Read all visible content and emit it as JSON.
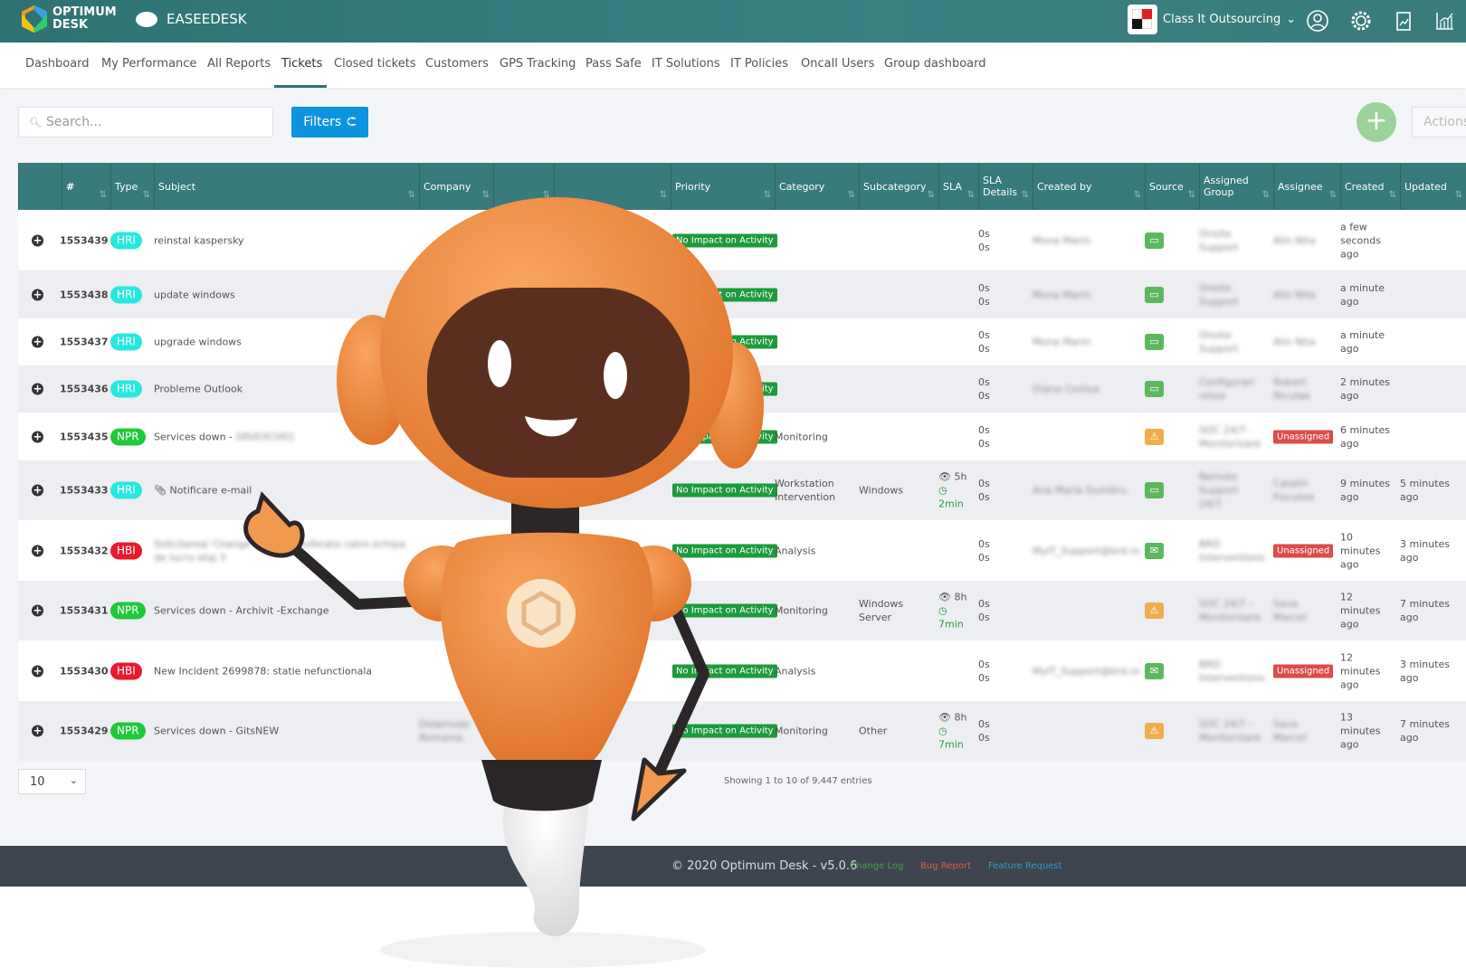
{
  "brand": {
    "logo_text_1": "OPTIMUM",
    "logo_text_2": "DESK",
    "product": "EASEEDESK"
  },
  "topbar": {
    "company": "Class It Outsourcing",
    "icons": [
      "user-circle-icon",
      "gear-icon",
      "clipboard-chart-icon",
      "bar-chart-icon"
    ]
  },
  "nav": {
    "items": [
      "Dashboard",
      "My Performance",
      "All Reports",
      "Tickets",
      "Closed tickets",
      "Customers",
      "GPS Tracking",
      "Pass Safe",
      "IT Solutions",
      "IT Policies",
      "Oncall Users",
      "Group dashboard"
    ],
    "active": "Tickets"
  },
  "toolbar": {
    "search_placeholder": "Search...",
    "filters_label": "Filters",
    "add_label": "+",
    "actions_label": "Actions"
  },
  "table": {
    "columns": [
      "#",
      "Type",
      "Subject",
      "Company",
      "",
      "",
      "Priority",
      "Category",
      "Subcategory",
      "SLA",
      "SLA Details",
      "Created by",
      "Source",
      "Assigned Group",
      "Assignee",
      "Created",
      "Updated"
    ],
    "rows": [
      {
        "id": "1553439",
        "type": "HRI",
        "subject": "reinstal kaspersky",
        "priority": "No Impact on Activity",
        "category": "",
        "subcategory": "",
        "sla": "",
        "sla_time": "",
        "sla_details": [
          "0s",
          "0s"
        ],
        "created_by": "Mona Marin",
        "source": "monitor",
        "group": "Onsite Support",
        "assignee": "Alin Nita",
        "created": "a few seconds ago",
        "updated": ""
      },
      {
        "id": "1553438",
        "type": "HRI",
        "subject": "update windows",
        "priority": "No Impact on Activity",
        "category": "",
        "subcategory": "",
        "sla": "",
        "sla_time": "",
        "sla_details": [
          "0s",
          "0s"
        ],
        "created_by": "Mona Marin",
        "source": "monitor",
        "group": "Onsite Support",
        "assignee": "Alin Nita",
        "created": "a minute ago",
        "updated": ""
      },
      {
        "id": "1553437",
        "type": "HRI",
        "subject": "upgrade windows",
        "priority": "No Impact on Activity",
        "category": "",
        "subcategory": "",
        "sla": "",
        "sla_time": "",
        "sla_details": [
          "0s",
          "0s"
        ],
        "created_by": "Mona Marin",
        "source": "monitor",
        "group": "Onsite Support",
        "assignee": "Alin Nita",
        "created": "a minute ago",
        "updated": ""
      },
      {
        "id": "1553436",
        "type": "HRI",
        "subject": "Probleme Outlook",
        "priority": "No Impact on Activity",
        "category": "",
        "subcategory": "",
        "sla": "",
        "sla_time": "",
        "sla_details": [
          "0s",
          "0s"
        ],
        "created_by": "Diana Costea",
        "source": "monitor",
        "group": "Configurari retea",
        "assignee": "Robert Niculae",
        "created": "2 minutes ago",
        "updated": ""
      },
      {
        "id": "1553435",
        "type": "NPR",
        "subject": "Services down - ",
        "subject_blur": "SRVEXCH01",
        "priority": "No Impact on Activity",
        "category": "Monitoring",
        "subcategory": "",
        "sla": "",
        "sla_time": "",
        "sla_details": [
          "0s",
          "0s"
        ],
        "created_by": "",
        "source": "warning",
        "group": "SOC 24/7 - Monitorizare",
        "assignee_status": "Unassigned",
        "created": "6 minutes ago",
        "updated": ""
      },
      {
        "id": "1553433",
        "type": "HRI",
        "subject": "Notificare e-mail",
        "attachment": true,
        "priority": "No Impact on Activity",
        "category": "Workstation Intervention",
        "subcategory": "Windows",
        "sla": "5h",
        "sla_time": "2min",
        "sla_details": [
          "0s",
          "0s"
        ],
        "created_by": "Ana Maria Dumitru",
        "source": "monitor",
        "group": "Remote Support 24/7",
        "assignee": "Catalin Fiscutea",
        "created": "9 minutes ago",
        "updated": "5 minutes ago"
      },
      {
        "id": "1553432",
        "type": "HBI",
        "subject": "",
        "subject_blur": "Solicitarea/ Change a fost transferata catre echipa de lucru etaj 3",
        "priority": "No Impact on Activity",
        "category": "Analysis",
        "subcategory": "",
        "sla": "",
        "sla_time": "",
        "sla_details": [
          "0s",
          "0s"
        ],
        "created_by": "MyIT_Support@brd.ro",
        "source": "email",
        "group": "BRD Interventions",
        "assignee_status": "Unassigned",
        "created": "10 minutes ago",
        "updated": "3 minutes ago"
      },
      {
        "id": "1553431",
        "type": "NPR",
        "subject": "Services down - Archivit -Exchange",
        "priority": "No Impact on Activity",
        "category": "Monitoring",
        "subcategory": "Windows Server",
        "sla": "8h",
        "sla_time": "7min",
        "sla_details": [
          "0s",
          "0s"
        ],
        "created_by": "",
        "source": "warning",
        "group": "SOC 24/7 - Monitorizare",
        "assignee": "Sava Marcel",
        "created": "12 minutes ago",
        "updated": "7 minutes ago"
      },
      {
        "id": "1553430",
        "type": "HBI",
        "subject": "New Incident 2699878: statie nefunctionala",
        "priority": "No Impact on Activity",
        "category": "Analysis",
        "subcategory": "",
        "sla": "",
        "sla_time": "",
        "sla_details": [
          "0s",
          "0s"
        ],
        "created_by": "MyIT_Support@brd.ro",
        "source": "email",
        "group": "BRD Interventions",
        "assignee_status": "Unassigned",
        "created": "12 minutes ago",
        "updated": "3 minutes ago"
      },
      {
        "id": "1553429",
        "type": "NPR",
        "subject": "Services down - GitsNEW",
        "priority": "No Impact on Activity",
        "category": "Monitoring",
        "subcategory": "Other",
        "sla": "8h",
        "sla_time": "7min",
        "sla_details": [
          "0s",
          "0s"
        ],
        "company": "Delamode Romania",
        "created_by": "",
        "source": "warning",
        "group": "SOC 24/7 - Monitorizare",
        "assignee": "Sava Marcel",
        "created": "13 minutes ago",
        "updated": "7 minutes ago"
      }
    ]
  },
  "pagination": {
    "page_size": "10",
    "showing": "Showing 1 to 10 of 9,447 entries"
  },
  "footer": {
    "copyright": "© 2020 Optimum Desk - v5.0.6",
    "change_log": "Change Log",
    "bug_report": "Bug Report",
    "feature_request": "Feature Request"
  },
  "colors": {
    "topbar": "#3a7b7c",
    "HRI": "#27e8e0",
    "NPR": "#1ec93a",
    "HBI": "#e8192c",
    "filters": "#0e93df",
    "priority": "#1e9a3c",
    "unassigned": "#dd4b4b",
    "monitor": "#5cb85c",
    "warning": "#f0ad4e",
    "mascot": "#ef8a3c"
  }
}
